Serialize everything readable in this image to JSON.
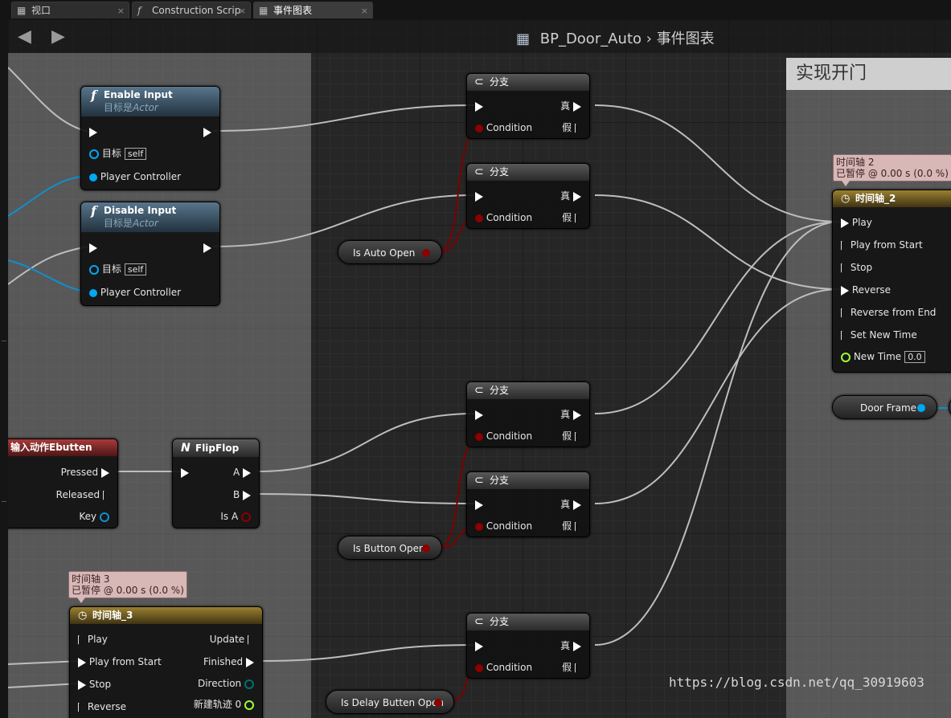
{
  "tabs": [
    {
      "label": "视口",
      "close": "×"
    },
    {
      "label": "Construction Scrip",
      "close": "×"
    },
    {
      "label": "事件图表",
      "close": "×"
    }
  ],
  "breadcrumb": {
    "blueprint": "BP_Door_Auto",
    "separator": "›",
    "graph": "事件图表"
  },
  "comment": {
    "title": "实现开门"
  },
  "nodes": {
    "enable_input": {
      "title": "Enable Input",
      "subtitle_prefix": "目标是",
      "subtitle_class": "Actor",
      "target_label": "目标",
      "target_value": "self",
      "player_controller": "Player Controller"
    },
    "disable_input": {
      "title": "Disable Input",
      "subtitle_prefix": "目标是",
      "subtitle_class": "Actor",
      "target_label": "目标",
      "target_value": "self",
      "player_controller": "Player Controller"
    },
    "branch": {
      "title": "分支",
      "condition": "Condition",
      "true_label": "真",
      "false_label": "假"
    },
    "input_action": {
      "title_prefix": "输入动作",
      "title_name": "Ebutten",
      "pressed": "Pressed",
      "released": "Released",
      "key": "Key"
    },
    "flipflop": {
      "title": "FlipFlop",
      "a": "A",
      "b": "B",
      "is_a": "Is A"
    },
    "timeline2": {
      "title_prefix": "时间轴",
      "title_suffix": "_2",
      "play": "Play",
      "play_from_start": "Play from Start",
      "stop": "Stop",
      "reverse": "Reverse",
      "reverse_from_end": "Reverse from End",
      "set_new_time": "Set New Time",
      "new_time": "New Time",
      "new_time_value": "0.0",
      "tooltip_line1": "时间轴 2",
      "tooltip_line2": "已暂停 @ 0.00 s (0.0 %)"
    },
    "timeline3": {
      "title_prefix": "时间轴",
      "title_suffix": "_3",
      "play": "Play",
      "play_from_start": "Play from Start",
      "stop": "Stop",
      "reverse": "Reverse",
      "update": "Update",
      "finished": "Finished",
      "direction": "Direction",
      "new_track": "新建轨迹 0",
      "tooltip_line1": "时间轴 3",
      "tooltip_line2": "已暂停 @ 0.00 s (0.0 %)"
    }
  },
  "variables": {
    "is_auto_open": "Is Auto Open",
    "is_button_open": "Is Button Open",
    "is_delay_button_open": "Is Delay Butten Open",
    "door_frame": "Door Frame"
  },
  "watermark": "https://blog.csdn.net/qq_30919603",
  "colors": {
    "exec": "#ffffff",
    "bool": "#8b0000",
    "object": "#00a8f3",
    "float": "#9bff35",
    "direction": "#00726b"
  }
}
